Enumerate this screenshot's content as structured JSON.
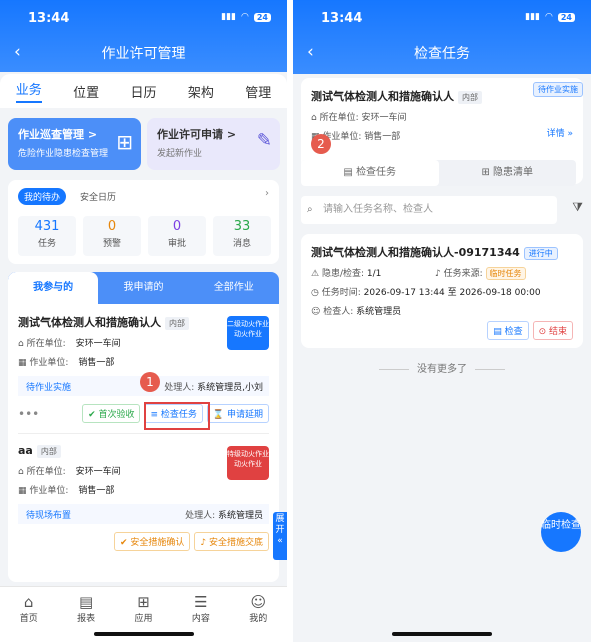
{
  "status": {
    "time": "13:44",
    "battery": "24"
  },
  "screen1": {
    "title": "作业许可管理",
    "tabs": [
      "业务",
      "位置",
      "日历",
      "架构",
      "管理"
    ],
    "quick": [
      {
        "title": "作业巡查管理 >",
        "sub": "危险作业隐患检查管理"
      },
      {
        "title": "作业许可申请 >",
        "sub": "发起新作业"
      }
    ],
    "pending": {
      "tab_active": "我的待办",
      "tab_other": "安全日历",
      "stats": [
        {
          "n": "431",
          "l": "任务"
        },
        {
          "n": "0",
          "l": "预警"
        },
        {
          "n": "0",
          "l": "审批"
        },
        {
          "n": "33",
          "l": "消息"
        }
      ]
    },
    "list_tabs": [
      "我参与的",
      "我申请的",
      "全部作业"
    ],
    "items": [
      {
        "name": "测试气体检测人和措施确认人",
        "tag": "内部",
        "unit_label": "所在单位:",
        "unit": "安环一车间",
        "work_label": "作业单位:",
        "work": "销售一部",
        "badge": "二级动火作业 动火作业",
        "status": "待作业实施",
        "handler_label": "处理人:",
        "handler": "系统管理员,小刘",
        "b1": "首次验收",
        "b2": "检查任务",
        "b3": "申请延期"
      },
      {
        "name": "aa",
        "tag": "内部",
        "unit_label": "所在单位:",
        "unit": "安环一车间",
        "work_label": "作业单位:",
        "work": "销售一部",
        "badge": "特级动火作业 动火作业",
        "status": "待现场布置",
        "handler_label": "处理人:",
        "handler": "系统管理员",
        "b1": "安全措施确认",
        "b2": "安全措施交底"
      }
    ],
    "side": "展开",
    "nav": [
      "首页",
      "报表",
      "应用",
      "内容",
      "我的"
    ]
  },
  "screen2": {
    "title": "检查任务",
    "card": {
      "name": "测试气体检测人和措施确认人",
      "tag": "内部",
      "ribbon": "待作业实施",
      "unit_label": "所在单位:",
      "unit": "安环一车间",
      "work_label": "作业单位:",
      "work": "销售一部",
      "detail": "详情 »"
    },
    "seg": [
      "检查任务",
      "隐患清单"
    ],
    "search_placeholder": "请输入任务名称、检查人",
    "task": {
      "name": "测试气体检测人和措施确认人-09171344",
      "state": "进行中",
      "ratio_label": "隐患/检查:",
      "ratio": "1/1",
      "src_label": "任务来源:",
      "src": "临时任务",
      "time_label": "任务时间:",
      "time": "2026-09-17 13:44 至 2026-09-18 00:00",
      "checker_label": "检查人:",
      "checker": "系统管理员",
      "b1": "检查",
      "b2": "结束"
    },
    "nomore": "没有更多了",
    "fab": "临时检查"
  },
  "callouts": [
    "1",
    "2"
  ]
}
